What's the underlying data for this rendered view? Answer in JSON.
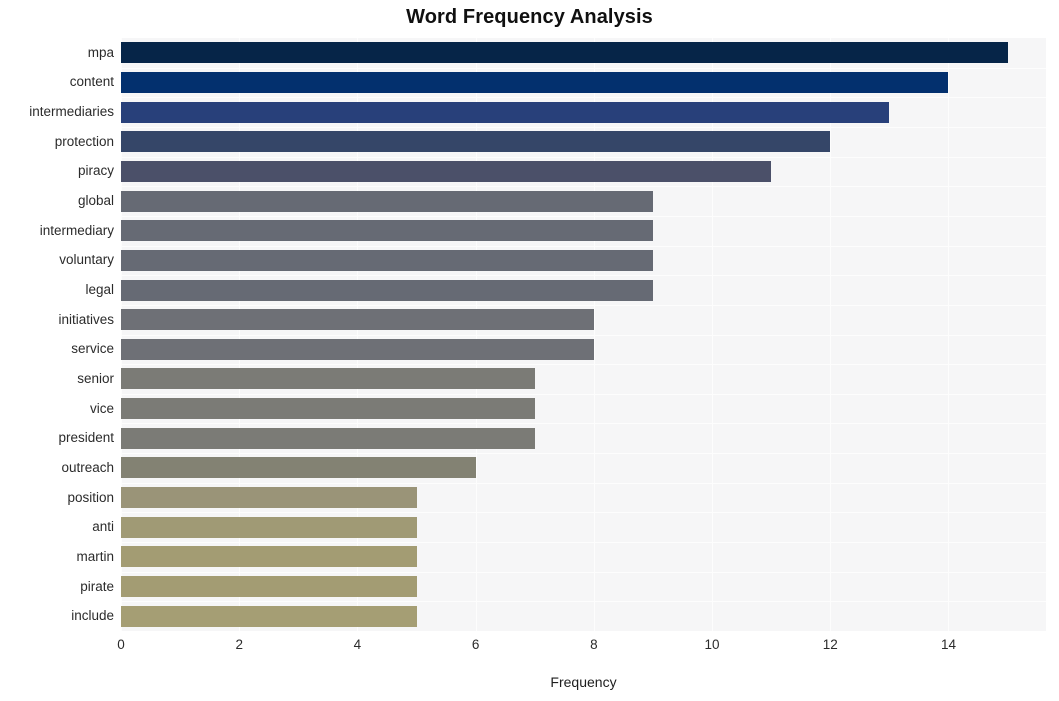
{
  "chart_data": {
    "type": "bar",
    "orientation": "horizontal",
    "title": "Word Frequency Analysis",
    "xlabel": "Frequency",
    "ylabel": "",
    "categories": [
      "mpa",
      "content",
      "intermediaries",
      "protection",
      "piracy",
      "global",
      "intermediary",
      "voluntary",
      "legal",
      "initiatives",
      "service",
      "senior",
      "vice",
      "president",
      "outreach",
      "position",
      "anti",
      "martin",
      "pirate",
      "include"
    ],
    "values": [
      15,
      14,
      13,
      12,
      11,
      9,
      9,
      9,
      9,
      8,
      8,
      7,
      7,
      7,
      6,
      5,
      5,
      5,
      5,
      5
    ],
    "bar_colors": [
      "#062548",
      "#03306e",
      "#28407a",
      "#354668",
      "#4b5069",
      "#666a74",
      "#666a74",
      "#666a74",
      "#666a74",
      "#6e7076",
      "#6e7076",
      "#7b7b76",
      "#7b7b76",
      "#7b7b76",
      "#838273",
      "#9a9478",
      "#a09a75",
      "#a39c73",
      "#a39c73",
      "#a59e74"
    ],
    "xlim": [
      0,
      15.65
    ],
    "xticks": [
      0,
      2,
      4,
      6,
      8,
      10,
      12,
      14
    ],
    "xtick_labels": [
      "0",
      "2",
      "4",
      "6",
      "8",
      "10",
      "12",
      "14"
    ],
    "grid": true,
    "grid_color": "#fdfdfd",
    "plot_background": "#f6f6f7",
    "figure_background": "#ffffff",
    "legend": null
  }
}
